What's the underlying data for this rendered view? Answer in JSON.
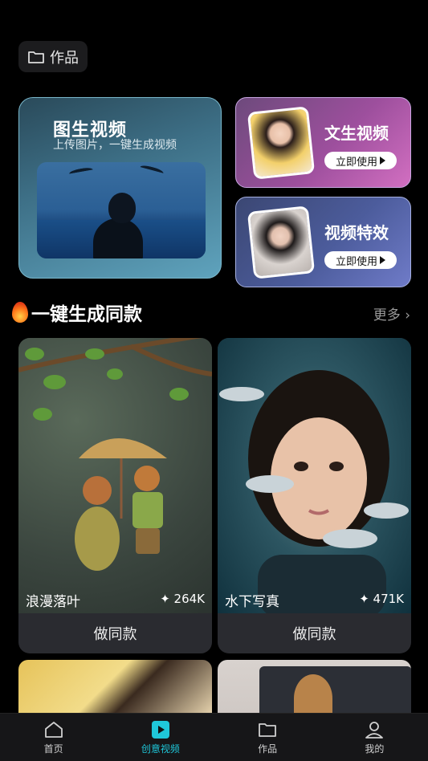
{
  "top": {
    "works_label": "作品"
  },
  "feature_main": {
    "title": "图生视频",
    "subtitle": "上传图片，一键生成视频"
  },
  "feature_cards": [
    {
      "title": "文生视频",
      "button": "立即使用"
    },
    {
      "title": "视频特效",
      "button": "立即使用"
    }
  ],
  "section": {
    "title": "一键生成同款",
    "more": "更多 ›"
  },
  "templates": [
    {
      "label": "浪漫落叶",
      "uses": "✦ 264K",
      "action": "做同款"
    },
    {
      "label": "水下写真",
      "uses": "✦ 471K",
      "action": "做同款"
    }
  ],
  "tabs": [
    {
      "label": "首页",
      "icon": "home-icon",
      "active": false
    },
    {
      "label": "创意视频",
      "icon": "play-icon",
      "active": true
    },
    {
      "label": "作品",
      "icon": "folder-icon",
      "active": false
    },
    {
      "label": "我的",
      "icon": "person-icon",
      "active": false
    }
  ],
  "colors": {
    "accent": "#1fc7d9",
    "background": "#000000"
  }
}
